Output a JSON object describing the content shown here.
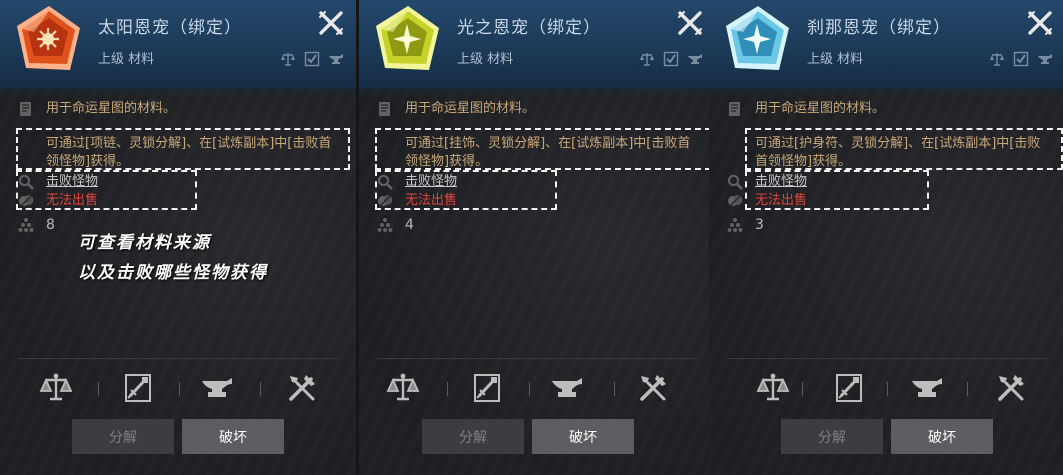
{
  "panels": [
    {
      "name": "太阳恩宠（绑定）",
      "grade": "上级 材料",
      "description": "用于命运星图的材料。",
      "source": "可通过[项链、灵锁分解]、在[试炼副本]中[击败首领怪物]获得。",
      "monster_link": "击败怪物",
      "sell_status": "无法出售",
      "quantity": "8",
      "icon": "sun-gem-icon",
      "gem_color": "#e0521c",
      "buttons": {
        "dismantle": "分解",
        "destroy": "破坏"
      }
    },
    {
      "name": "光之恩宠（绑定）",
      "grade": "上级 材料",
      "description": "用于命运星图的材料。",
      "source": "可通过[挂饰、灵锁分解]、在[试炼副本]中[击败首领怪物]获得。",
      "monster_link": "击败怪物",
      "sell_status": "无法出售",
      "quantity": "4",
      "icon": "light-gem-icon",
      "gem_color": "#c6d22a",
      "buttons": {
        "dismantle": "分解",
        "destroy": "破坏"
      }
    },
    {
      "name": "刹那恩宠（绑定）",
      "grade": "上级 材料",
      "description": "用于命运星图的材料。",
      "source": "可通过[护身符、灵锁分解]、在[试炼副本]中[击败首领怪物]获得。",
      "monster_link": "击败怪物",
      "sell_status": "无法出售",
      "quantity": "3",
      "icon": "instant-gem-icon",
      "gem_color": "#6cc6e6",
      "buttons": {
        "dismantle": "分解",
        "destroy": "破坏"
      }
    }
  ],
  "annotation": {
    "line1": "可查看材料来源",
    "line2": "以及击败哪些怪物获得"
  },
  "colors": {
    "header": "#1c3a58",
    "panel": "#1f2023",
    "source_text": "#c9a878",
    "no_sell": "#e2453c"
  }
}
